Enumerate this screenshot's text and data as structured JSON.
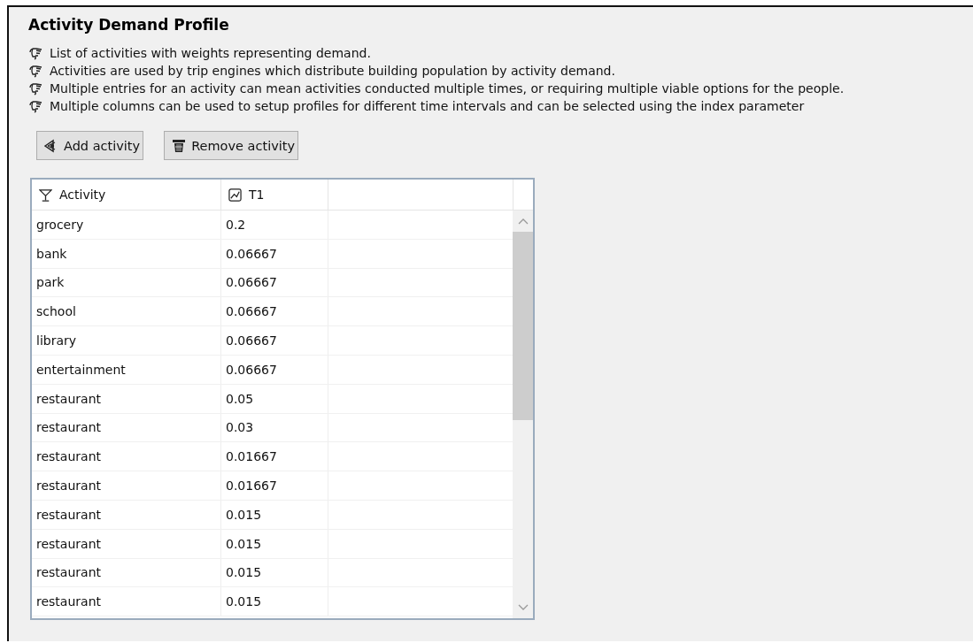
{
  "panel": {
    "title": "Activity Demand Profile"
  },
  "notes": [
    "List of activities with weights representing demand.",
    "Activities are used by trip engines which distribute building population by activity demand.",
    "Multiple entries for an activity can mean activities conducted multiple times, or requiring multiple viable options for the people.",
    "Multiple columns can be used to setup profiles for different time intervals and can be selected using the index parameter"
  ],
  "buttons": [
    {
      "label": "Add activity",
      "kind": "add"
    },
    {
      "label": "Remove activity",
      "kind": "remove"
    }
  ],
  "table": {
    "columns": [
      {
        "label": "Activity",
        "kind": "activity"
      },
      {
        "label": "T1",
        "kind": "series"
      }
    ],
    "rows": [
      {
        "activity": "grocery",
        "t1": "0.2"
      },
      {
        "activity": "bank",
        "t1": "0.06667"
      },
      {
        "activity": "park",
        "t1": "0.06667"
      },
      {
        "activity": "school",
        "t1": "0.06667"
      },
      {
        "activity": "library",
        "t1": "0.06667"
      },
      {
        "activity": "entertainment",
        "t1": "0.06667"
      },
      {
        "activity": "restaurant",
        "t1": "0.05"
      },
      {
        "activity": "restaurant",
        "t1": "0.03"
      },
      {
        "activity": "restaurant",
        "t1": "0.01667"
      },
      {
        "activity": "restaurant",
        "t1": "0.01667"
      },
      {
        "activity": "restaurant",
        "t1": "0.015"
      },
      {
        "activity": "restaurant",
        "t1": "0.015"
      },
      {
        "activity": "restaurant",
        "t1": "0.015"
      },
      {
        "activity": "restaurant",
        "t1": "0.015"
      }
    ]
  }
}
